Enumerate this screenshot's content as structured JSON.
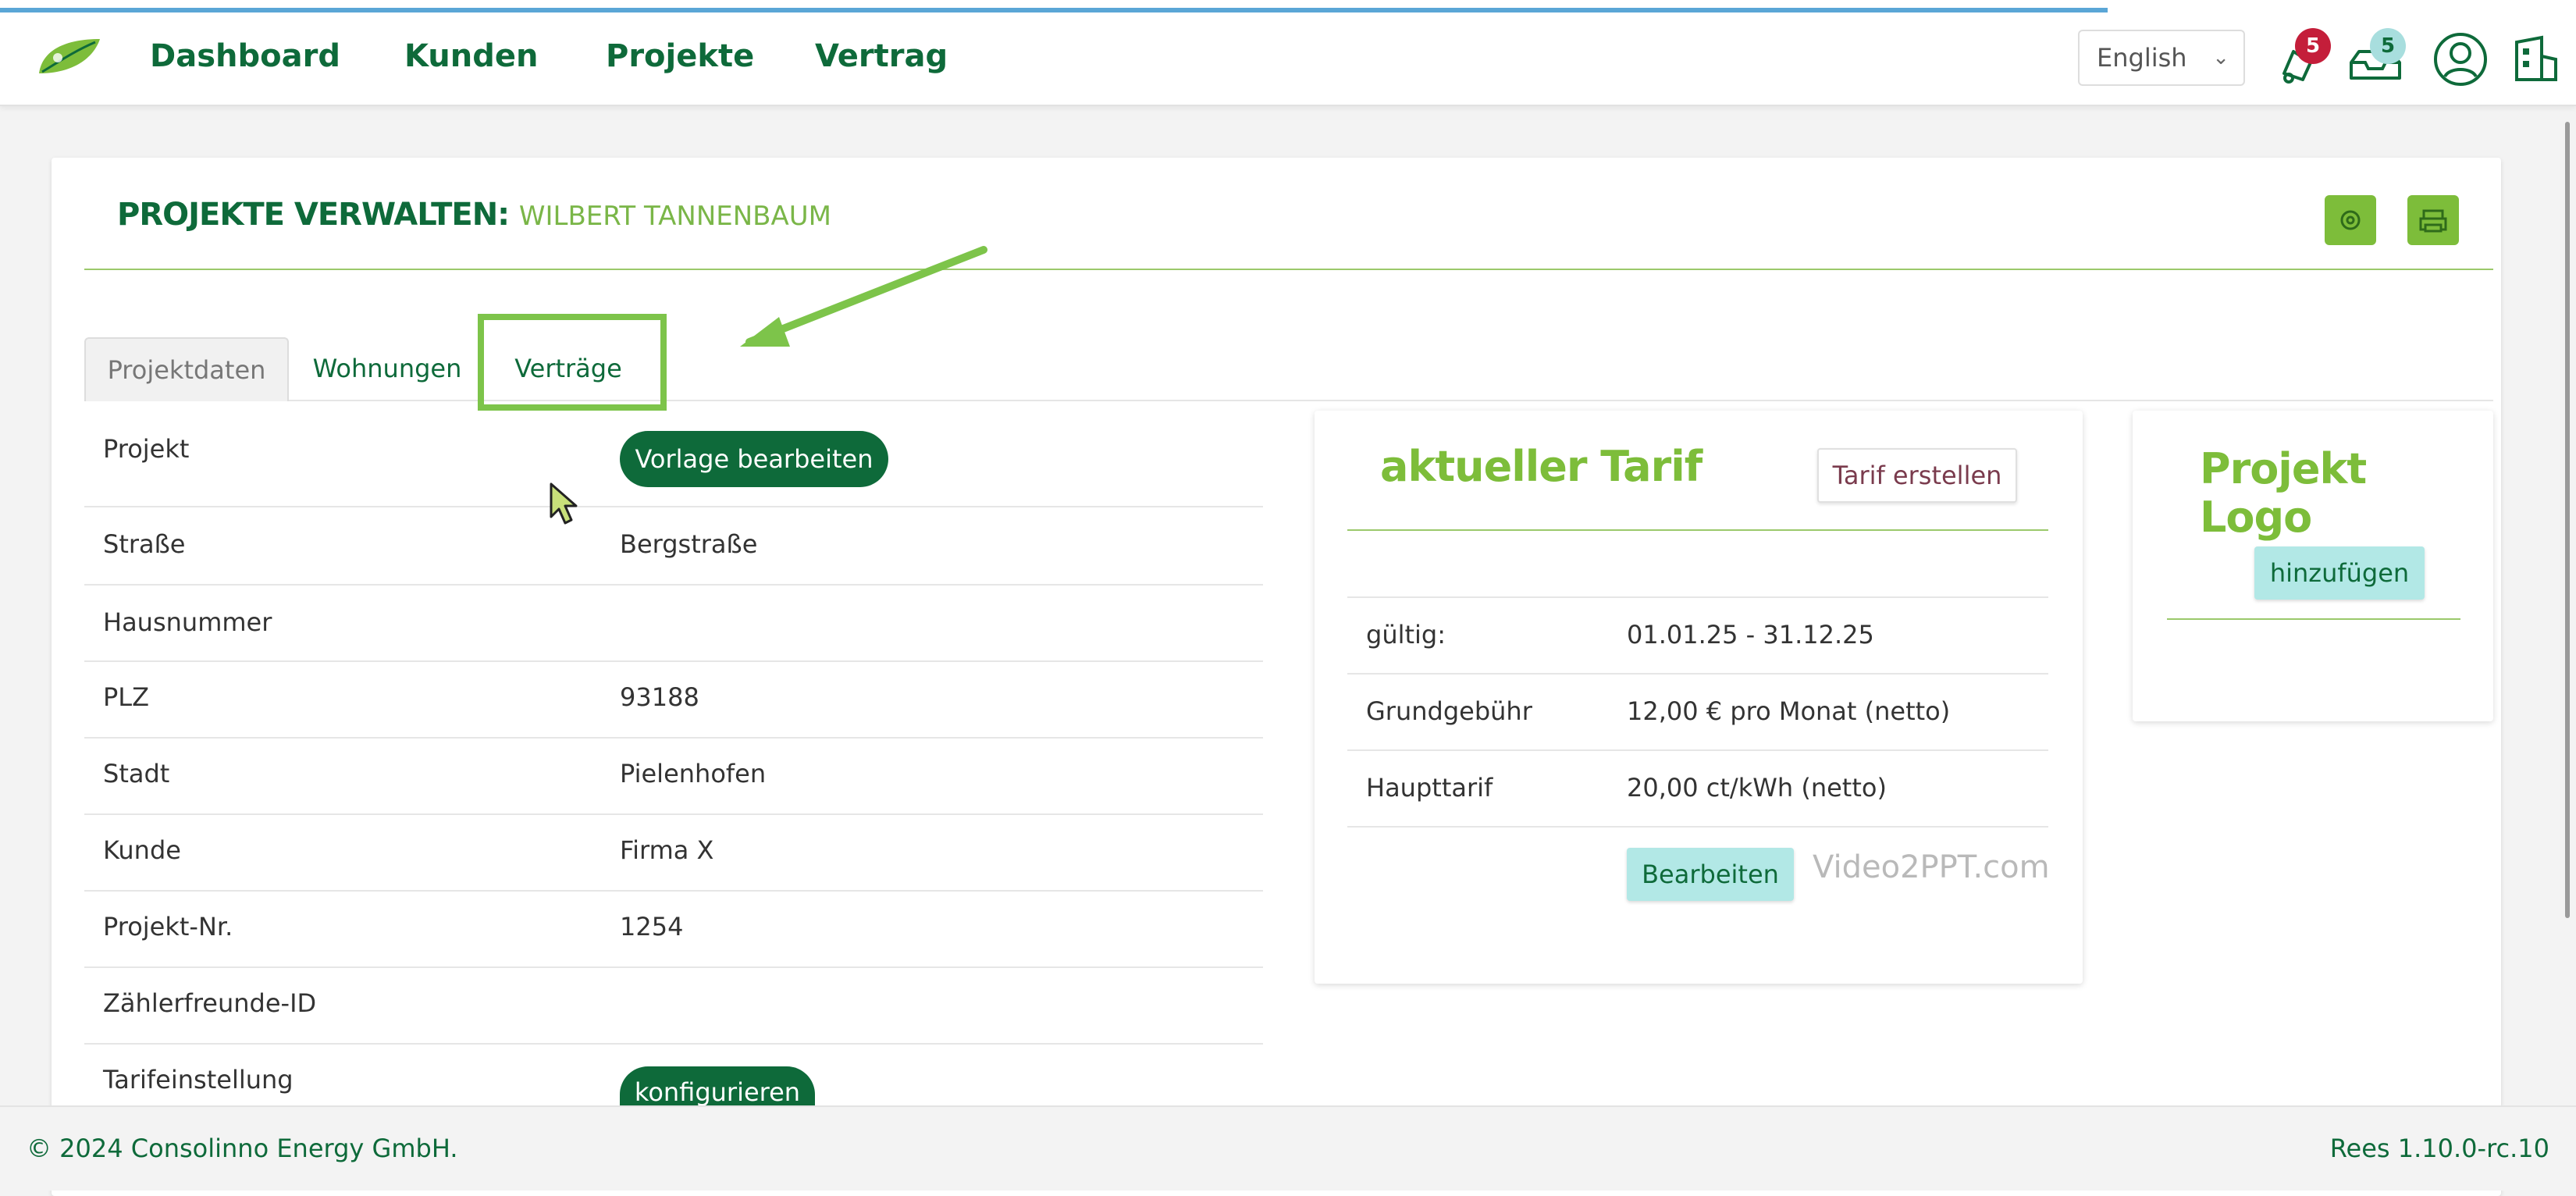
{
  "nav": {
    "items": [
      "Dashboard",
      "Kunden",
      "Projekte",
      "Vertrag"
    ],
    "language": "English",
    "notifications_count": "5",
    "messages_count": "5"
  },
  "page": {
    "title_bold": "PROJEKTE VERWALTEN:",
    "title_sub": "WILBERT TANNENBAUM"
  },
  "tabs": [
    "Projektdaten",
    "Wohnungen",
    "Verträge"
  ],
  "project_rows": [
    {
      "label": "Projekt",
      "value": ""
    },
    {
      "label": "Straße",
      "value": "Bergstraße"
    },
    {
      "label": "Hausnummer",
      "value": ""
    },
    {
      "label": "PLZ",
      "value": "93188"
    },
    {
      "label": "Stadt",
      "value": "Pielenhofen"
    },
    {
      "label": "Kunde",
      "value": "Firma X"
    },
    {
      "label": "Projekt-Nr.",
      "value": "1254"
    },
    {
      "label": "Zählerfreunde-ID",
      "value": ""
    },
    {
      "label": "Tarifeinstellung",
      "value": ""
    }
  ],
  "buttons": {
    "vorlage": "Vorlage bearbeiten",
    "konfigurieren": "konfigurieren",
    "tarif_erstellen": "Tarif erstellen",
    "bearbeiten": "Bearbeiten",
    "hinzufuegen": "hinzufügen"
  },
  "tarif": {
    "heading": "aktueller Tarif",
    "rows": [
      {
        "label": "gültig:",
        "value": "01.01.25 - 31.12.25"
      },
      {
        "label": "Grundgebühr",
        "value": "12,00 € pro Monat (netto)"
      },
      {
        "label": "Haupttarif",
        "value": "20,00 ct/kWh (netto)"
      }
    ]
  },
  "logo_card": {
    "heading_line1": "Projekt",
    "heading_line2": "Logo"
  },
  "watermark": "Video2PPT.com",
  "footer": {
    "copyright": "© 2024 Consolinno Energy GmbH.",
    "version": "Rees 1.10.0-rc.10"
  },
  "colors": {
    "brand_dark": "#0e6a3a",
    "brand_light": "#7dbd3a",
    "highlight": "#7dc44a",
    "teal": "#b2e8e6"
  },
  "icons": [
    "leaf-logo-icon",
    "bell-icon",
    "inbox-icon",
    "user-avatar-icon",
    "building-icon",
    "settings-icon",
    "print-icon"
  ]
}
